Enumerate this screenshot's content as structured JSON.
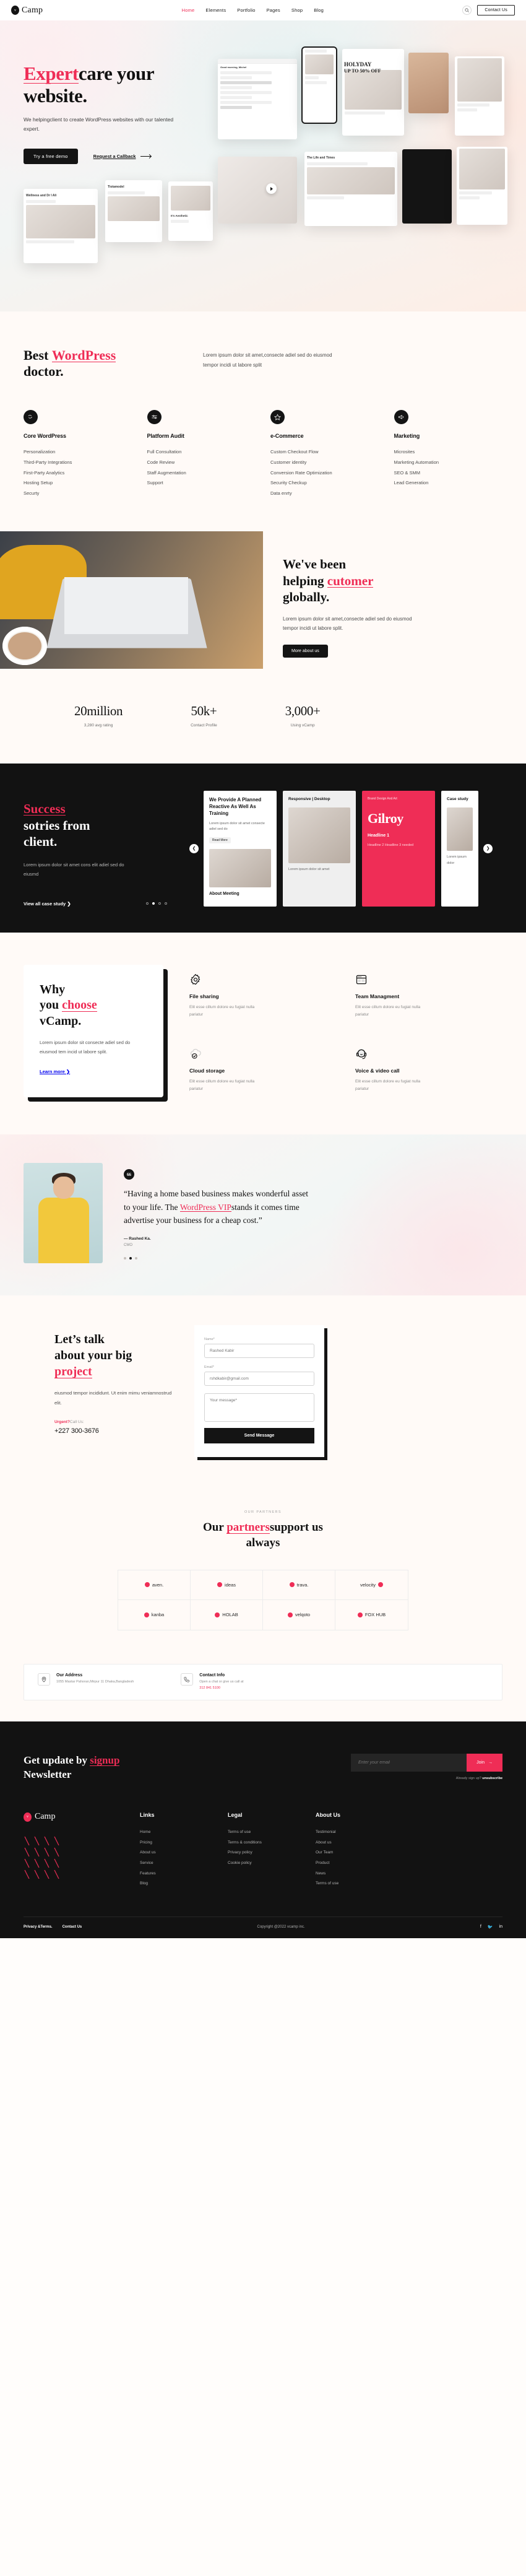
{
  "nav": {
    "brand_mark": "v",
    "brand": "Camp",
    "links": [
      "Home",
      "Elements",
      "Portfolio",
      "Pages",
      "Shop",
      "Blog"
    ],
    "active": "Home",
    "search_icon": "search-icon",
    "contact_label": "Contact Us"
  },
  "hero": {
    "title_accent": "Expert",
    "title_rest": "care your",
    "title_line2": "website.",
    "subtitle": "We helpingclient to create WordPress websites with our talented expert.",
    "primary_cta": "Try a free demo",
    "secondary_cta": "Request a Callback",
    "mock_holiday_1": "HOLYDAY",
    "mock_holiday_2": "UP TO 50% OFF",
    "mock_browser_title": "Good morning, Michel",
    "mock_video_title": "The Life and Times",
    "mock_card1_title": "Wellness and Dr I Ali",
    "mock_card2_title": "Tiotamodel",
    "mock_card3_title": "It's Aesthetic"
  },
  "services": {
    "title_1": "Best ",
    "title_accent": "WordPress",
    "title_2": "doctor.",
    "lead": "Lorem ipsum dolor sit amet,consecte adiel sed do eiusmod tempor incidi ut labore split",
    "columns": [
      {
        "icon": "wordpress-icon",
        "name": "Core WordPress",
        "items": [
          "Personalization",
          "Third-Party Integrations",
          "First-Party Analytics",
          "Hosting Setup",
          "Securty"
        ]
      },
      {
        "icon": "sliders-icon",
        "name": "Platform Audit",
        "items": [
          "Full Consultation",
          "Code Review",
          "Staff Augmentation",
          "Support"
        ]
      },
      {
        "icon": "star-icon",
        "name": "e-Commerce",
        "items": [
          "Custom Checkout Flow",
          "Customer identity",
          "Conversion Rate Optimization",
          "Security Checkup",
          "Data enrty"
        ]
      },
      {
        "icon": "megaphone-icon",
        "name": "Marketing",
        "items": [
          "Microsites",
          "Marketing Automation",
          "SEO & SMM",
          "Lead Generation"
        ]
      }
    ]
  },
  "helping": {
    "line1": "We've been",
    "line2_pre": "helping ",
    "line2_accent": "cutomer",
    "line3": "globally.",
    "paragraph": "Lorem ipsum dolor sit amet,consecte adiel sed do eiusmod tempor incidi ut labore split.",
    "button": "More about us"
  },
  "stats": [
    {
      "value": "20million",
      "label": "3,280 avg rating"
    },
    {
      "value": "50k+",
      "label": "Contact Profile"
    },
    {
      "value": "3,000+",
      "label": "Using vCamp"
    }
  ],
  "success": {
    "title_accent": "Success",
    "title_line2": "sotries from",
    "title_line3": "client.",
    "paragraph": "Lorem ipsum dolor sit amet cons elit adiel sed do eiusmd",
    "link": "View all case study ❯",
    "prev_icon": "chevron-left-icon",
    "next_icon": "chevron-right-icon",
    "cases": [
      {
        "title": "We Provide A Planned Reactive As Well As Training",
        "text": "Lorem ipsum dolor sit amet consecte adiel sed do",
        "chip": "Read More",
        "sub_title": "About Meeting"
      },
      {
        "title": "Responsive | Desktop",
        "text": "Lorem ipsum dolor sit amet"
      },
      {
        "title": "Gilroy",
        "headline": "Headline 1",
        "text": "Headline 2 Headline 3 needed",
        "sub": "Brand Design And Art"
      },
      {
        "title": "Case study",
        "text": "Lorem ipsum dolor"
      }
    ]
  },
  "why": {
    "line1": "Why",
    "line2_pre": "you ",
    "line2_accent": "choose",
    "line3": "vCamp.",
    "paragraph": "Lorem ipsum dolor sit consecte adiel sed do eiusmod tem incid ut labore split.",
    "link": "Learn more ❯",
    "features": [
      {
        "icon": "gear-icon",
        "title": "File sharing",
        "text": "Elit esse cillum dolore eu fugiat nulla pariatur"
      },
      {
        "icon": "window-layout-icon",
        "title": "Team Managment",
        "text": "Elit esse cillum dolore eu fugiat nulla pariatur"
      },
      {
        "icon": "cloud-check-icon",
        "title": "Cloud storage",
        "text": "Elit esse cillum dolore eu fugiat nulla pariatur"
      },
      {
        "icon": "headset-icon",
        "title": "Voice & video call",
        "text": "Elit esse cillum dolore eu fugiat nulla pariatur"
      }
    ]
  },
  "testimonial": {
    "badge": "66",
    "quote_1": "“Having a home based business makes wonderful asset to your life. The ",
    "quote_accent": "WordPress VIP",
    "quote_2": "stands it comes time advertise your business for a cheap cost.”",
    "author": "— Rashed Ka.",
    "role": "CMO"
  },
  "contact": {
    "line1": "Let’s talk",
    "line2": "about your big",
    "line3_accent": "project",
    "paragraph": "eiusmod tempor incididunt. Ut enim mimu veniamnostrud elit.",
    "urgent_label": "Urgent?",
    "urgent_sub": "Call Us:",
    "phone": "+227 300-3676",
    "form": {
      "name_label": "Name*",
      "name_placeholder": "Rashed Kabir",
      "email_label": "Email*",
      "email_placeholder": "rshdkabir@gmail.com",
      "message_placeholder": "Your message*",
      "submit": "Send Message"
    }
  },
  "partners": {
    "kicker": "OUR PARTNERS",
    "title_1": "Our ",
    "title_accent": "partners",
    "title_2": "support us",
    "title_3": "always",
    "logos": [
      "aven.",
      "ideas",
      "trava.",
      "velocity",
      "kanba",
      "HOLAB",
      "velqoto",
      "FOX HUB"
    ]
  },
  "address": {
    "address_icon": "map-pin-icon",
    "address_title": "Our Address",
    "address_text": "1055 Mastar Pahoran,Mirpur 11 Dhaka,Bangladesh",
    "contact_icon": "phone-icon",
    "contact_title": "Contact Info",
    "contact_text_1": "Open a chat or give us call at",
    "contact_text_2": "312 841 5100"
  },
  "footer": {
    "news_title_1": "Get update by ",
    "news_title_accent": "signup",
    "news_title_2": "Newsletter",
    "email_placeholder": "Enter your email",
    "join_label": "Join",
    "note_1": "Already sign up?",
    "note_2": "unsubscribe",
    "brand_mark": "v",
    "brand": "Camp",
    "columns": [
      {
        "heading": "Links",
        "items": [
          "Home",
          "Pricing",
          "About us",
          "Service",
          "Features",
          "Blog"
        ]
      },
      {
        "heading": "Legal",
        "items": [
          "Terms of use",
          "Terms & conditions",
          "Privacy policy",
          "Cookie policy"
        ]
      },
      {
        "heading": "About Us",
        "items": [
          "Testimonial",
          "About us",
          "Our Team",
          "Product",
          "News",
          "Terms of use"
        ]
      }
    ],
    "bottom_links": [
      "Privacy &Terms.",
      "Contact Us"
    ],
    "copyright": "Copyright @2022 vcamp inc.",
    "socials": [
      "facebook-icon",
      "twitter-icon",
      "linkedin-icon"
    ]
  }
}
